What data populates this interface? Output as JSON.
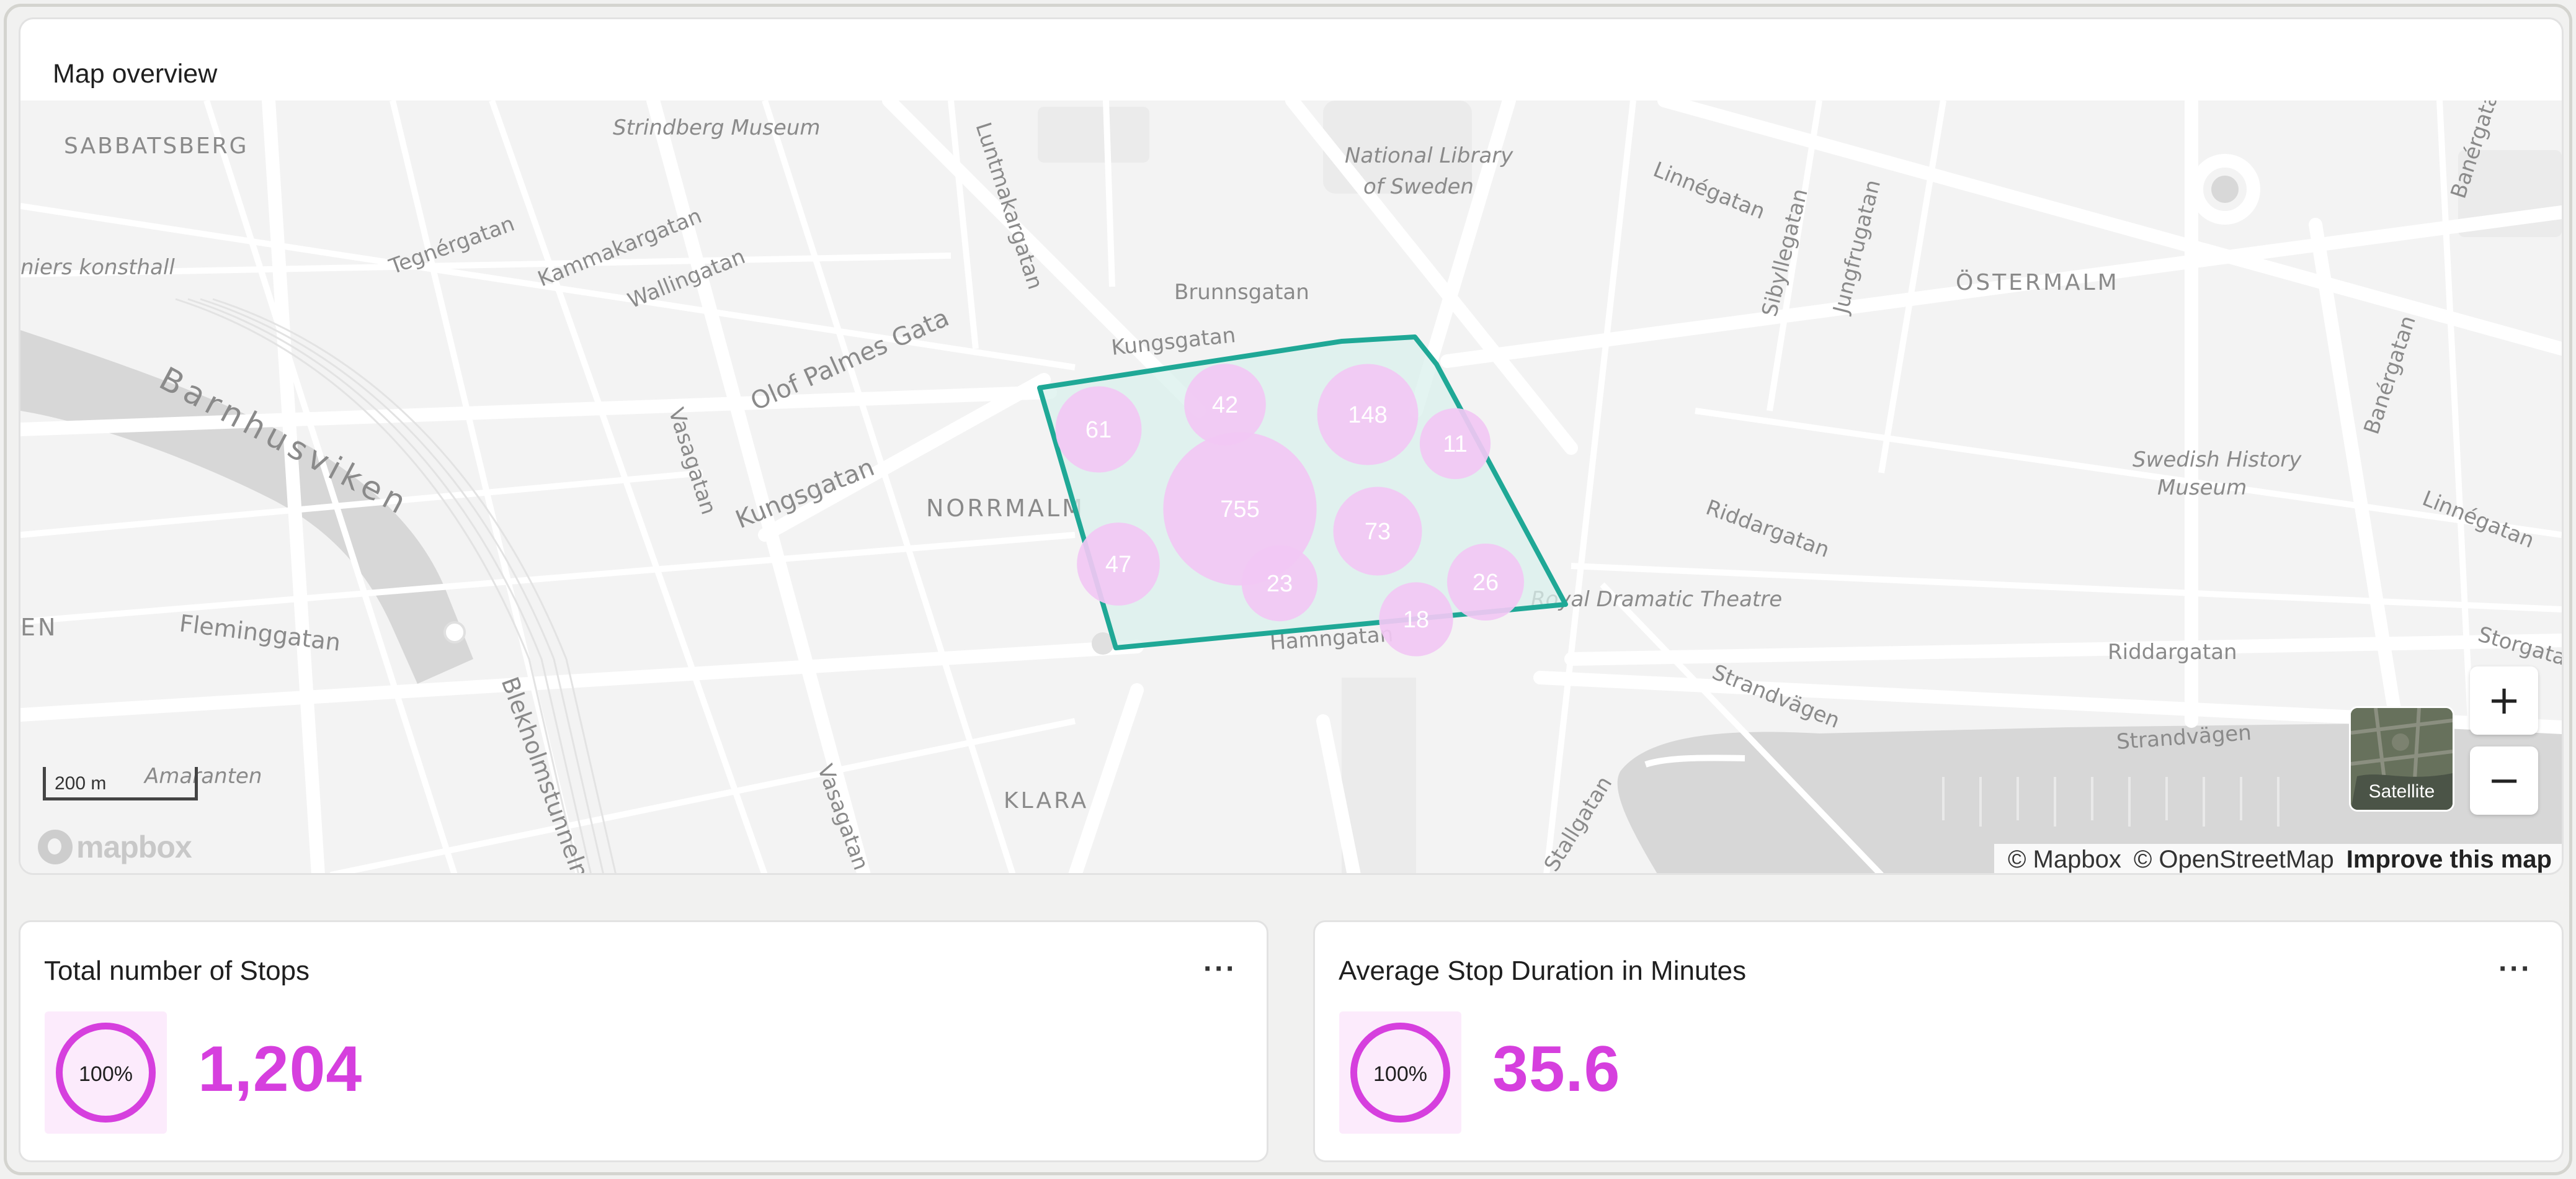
{
  "map_card": {
    "title": "Map overview",
    "scale_label": "200 m",
    "logo_text": "mapbox",
    "attribution": {
      "mapbox": "© Mapbox",
      "osm": "© OpenStreetMap",
      "improve": "Improve this map"
    },
    "satellite_label": "Satellite",
    "zoom_in_label": "+",
    "zoom_out_label": "−",
    "street_labels": [
      "SABBATSBERG",
      "Strindberg Museum",
      "Luntmakargatan",
      "National Library",
      "of Sweden",
      "Linnégatan",
      "Brunnsgatan",
      "Kungsgatan",
      "ÖSTERMALM",
      "Tegnérgatan",
      "Kammakargatan",
      "Wallingatan",
      "Sibyllegatan",
      "Jungfrugatan",
      "Olof Palmes Gata",
      "Barnhusviken",
      "Vasagatan",
      "Kungsgatan",
      "NORRMALM",
      "Swedish History",
      "Museum",
      "Riddargatan",
      "Royal Dramatic Theatre",
      "Fleminggatan",
      "Hamngatan",
      "Blekholmstunneln",
      "Strandvägen",
      "Riddargatan",
      "Strandvägen",
      "KLARA",
      "Vasagatan",
      "Stallgatan",
      "Banérgatan",
      "Linnégatan",
      "Storgatan",
      "Amaranten",
      "EN",
      "niers konsthall",
      "Banérgatan"
    ],
    "clusters": [
      {
        "label": "61",
        "count": 61
      },
      {
        "label": "42",
        "count": 42
      },
      {
        "label": "148",
        "count": 148
      },
      {
        "label": "11",
        "count": 11
      },
      {
        "label": "755",
        "count": 755
      },
      {
        "label": "73",
        "count": 73
      },
      {
        "label": "47",
        "count": 47
      },
      {
        "label": "23",
        "count": 23
      },
      {
        "label": "26",
        "count": 26
      },
      {
        "label": "18",
        "count": 18
      }
    ],
    "colors": {
      "polygon_stroke": "#1fa896",
      "polygon_fill": "#d9f0ec",
      "cluster_fill": "#f2c8f4"
    }
  },
  "stats": [
    {
      "title": "Total number of Stops",
      "percent_label": "100%",
      "percent": 100,
      "value": "1,204",
      "menu_label": "···"
    },
    {
      "title": "Average Stop Duration in Minutes",
      "percent_label": "100%",
      "percent": 100,
      "value": "35.6",
      "menu_label": "···"
    }
  ],
  "accent_color": "#d63fde"
}
